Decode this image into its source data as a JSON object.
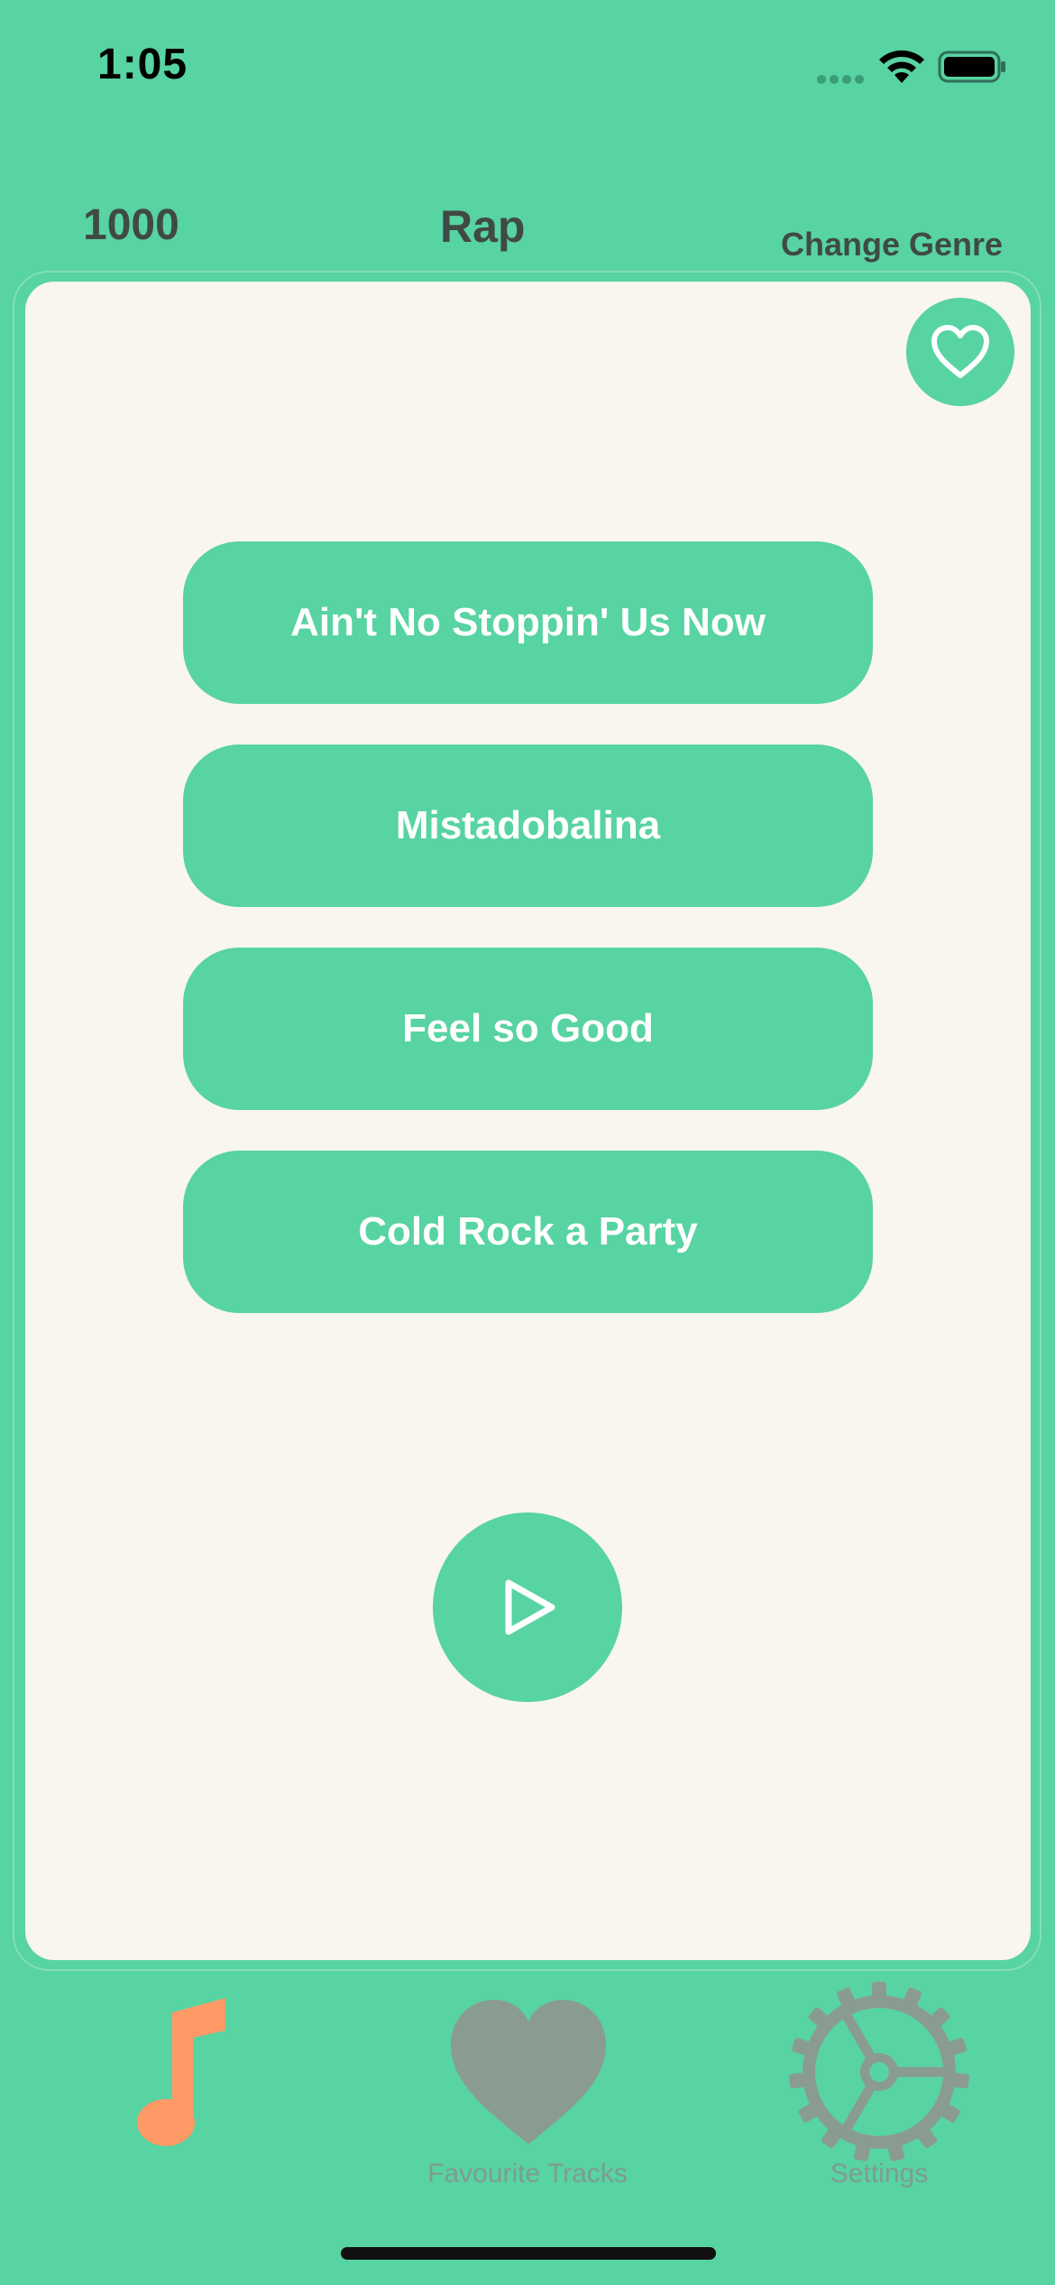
{
  "status_bar": {
    "time": "1:05"
  },
  "header": {
    "score": "1000",
    "genre": "Rap",
    "change_genre_label": "Change Genre"
  },
  "answers": [
    {
      "label": "Ain't No Stoppin' Us Now"
    },
    {
      "label": "Mistadobalina"
    },
    {
      "label": "Feel so Good"
    },
    {
      "label": "Cold Rock a Party"
    }
  ],
  "icons": {
    "favourite_button": "heart-outline-icon",
    "play": "play-icon",
    "tab_music": "music-note-icon",
    "tab_favourites": "heart-icon",
    "tab_settings": "gear-icon"
  },
  "tabs": [
    {
      "label": "",
      "active": true
    },
    {
      "label": "Favourite Tracks",
      "active": false
    },
    {
      "label": "Settings",
      "active": false
    }
  ],
  "colors": {
    "background": "#58d3a2",
    "card": "#f9f5ef",
    "active_tab": "#ff9a66",
    "inactive_tab": "#8a9b92",
    "text_dark": "#3f4a45"
  }
}
